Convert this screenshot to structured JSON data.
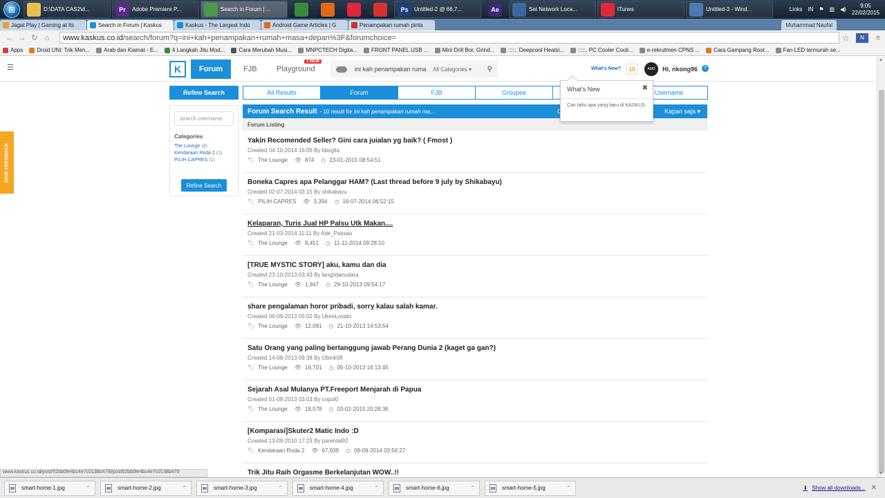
{
  "taskbar": {
    "items": [
      {
        "label": "D:\\DATA CAS2\\d...",
        "icon": "folder-icon",
        "color": "#e8c050"
      },
      {
        "label": "Adobe Premiere P...",
        "icon": "premiere-icon",
        "color": "#5a2a8a",
        "glyph": "Pr"
      },
      {
        "label": "Search in Forum | ...",
        "icon": "chrome-icon",
        "color": "#4a9a4a",
        "active": true
      },
      {
        "label": "",
        "icon": "sync-icon",
        "color": "#3a8a3a"
      },
      {
        "label": "",
        "icon": "firefox-icon",
        "color": "#e06a1a"
      },
      {
        "label": "",
        "icon": "itunes-icon",
        "color": "#e0283a"
      },
      {
        "label": "",
        "icon": "itunes-badge-icon",
        "color": "#d93030"
      },
      {
        "label": "Untitled-2 @ 66,7...",
        "icon": "photoshop-icon",
        "color": "#1b3f7a",
        "glyph": "Ps"
      },
      {
        "label": "",
        "icon": "after-effects-icon",
        "color": "#3b2a7a",
        "glyph": "Ae"
      },
      {
        "label": "Set Network Loca...",
        "icon": "network-icon",
        "color": "#3a6aa0"
      },
      {
        "label": "iTunes",
        "icon": "itunes-icon",
        "color": "#e0283a"
      },
      {
        "label": "Untitled-3 - Wind...",
        "icon": "moviemaker-icon",
        "color": "#4a7ab0"
      }
    ],
    "links": "Links",
    "lang": "IN",
    "time": "9:05",
    "date": "22/02/2015"
  },
  "browser_tabs": [
    {
      "label": "Jagat Play | Gaming at its",
      "color": "#e8a030"
    },
    {
      "label": "Search in Forum | Kaskus",
      "color": "#1c8fdb",
      "active": true
    },
    {
      "label": "Kaskus - The Largest Indo",
      "color": "#1c8fdb"
    },
    {
      "label": "Android Game Articles | G",
      "color": "#e06a1a"
    },
    {
      "label": "Penampakan rumah pinta",
      "color": "#d03030"
    }
  ],
  "browser_user": "Muhammad Naufal",
  "omnibox": {
    "host": "www.kaskus.co.id",
    "path": "/search/forum?q=ini+kah+penampakan+rumah+masa+depan%3F&forumchoice="
  },
  "bookmarks": [
    {
      "label": "Apps",
      "color": "#d04040"
    },
    {
      "label": "Droid UNI: Trik Men...",
      "color": "#e07a20"
    },
    {
      "label": "Arab dan Kiamat - E...",
      "color": "#888888"
    },
    {
      "label": "4 Langkah Jitu Mod...",
      "color": "#3a8a3a"
    },
    {
      "label": "Cara Merubah Musi...",
      "color": "#555555"
    },
    {
      "label": "MNPCTECH Digita...",
      "color": "#888888"
    },
    {
      "label": "FRONT PANEL USB ...",
      "color": "#888888"
    },
    {
      "label": "Mini Drill Bor, Grind...",
      "color": "#888888"
    },
    {
      "label": ":::::. Deepcool Heatsi...",
      "color": "#888888"
    },
    {
      "label": ":::::. PC Cooler Cooli...",
      "color": "#888888"
    },
    {
      "label": "e-rekrutmen CPNS ...",
      "color": "#888888"
    },
    {
      "label": "Cara Gampang Root...",
      "color": "#e07a20"
    },
    {
      "label": "Fan LED termurah se...",
      "color": "#888888"
    }
  ],
  "kaskus": {
    "nav_forum": "Forum",
    "nav_fjb": "FJB",
    "nav_playground": "Playground",
    "new_badge": "1 NEW",
    "search_query": "ini kah penampakan ruma",
    "search_category": "All Categories",
    "whats_new_link": "What's New?",
    "whats_new_count": "10",
    "avatar_text": "AMD",
    "greeting": "Hi, nkong96",
    "feedback": "GIVE FEEDBACK"
  },
  "sidebar": {
    "refine_title": "Refine Search",
    "username_placeholder": "search username",
    "categories_heading": "Categories",
    "categories": [
      {
        "name": "The Lounge",
        "count": "(8)"
      },
      {
        "name": "Kendaraan Roda 2",
        "count": "(1)"
      },
      {
        "name": "PILIH CAPRES",
        "count": "(1)"
      }
    ],
    "refine_button": "Refine Search"
  },
  "filter_tabs": [
    {
      "label": "All Results"
    },
    {
      "label": "Forum",
      "active": true
    },
    {
      "label": "FJB"
    },
    {
      "label": "Groupee"
    },
    {
      "label": ""
    },
    {
      "label": "Username"
    }
  ],
  "results": {
    "title": "Forum Search Result",
    "summary_prefix": "- 10 result for",
    "summary_query": "ini kah penampakan rumah ma...",
    "extra": "C",
    "time_filter": "Kapan saja",
    "listing_heading": "Forum Listing"
  },
  "popup": {
    "title": "What's New",
    "body": "Cari tahu apa yang baru di KASKUS."
  },
  "threads": [
    {
      "title": "Yakin Recomended Seller? Gini cara juialan yg baik? ( Fmost )",
      "created": "Created 04-10-2014 16:09 By bbxgila",
      "category": "The Lounge",
      "views": "874",
      "last": "23-01-2015 08:54:51"
    },
    {
      "title": "Boneka Capres apa Pelanggar HAM? (Last thread before 9 july by Shikabayu)",
      "created": "Created 02-07-2014 03:15 By shikabayu",
      "category": "PILIH CAPRES",
      "views": "3,394",
      "last": "16-07-2014 06:52:15"
    },
    {
      "title": "Kelaparan, Turis Jual HP Palsu Utk Makan....",
      "created": "Created 21-03-2014 11:11 By Ade_Passau",
      "category": "The Lounge",
      "views": "8,451",
      "last": "11-11-2014 09:28:10",
      "underline": true
    },
    {
      "title": "[TRUE MYSTIC STORY] aku, kamu dan dia",
      "created": "Created 23-10-2013 03:43 By langitdanudara",
      "category": "The Lounge",
      "views": "1,947",
      "last": "29-10-2013 09:54:17"
    },
    {
      "title": "share pengalaman horor pribadi, sorry kalau salah kamar.",
      "created": "Created 06-09-2013 05:02 By UkeeLovato",
      "category": "The Lounge",
      "views": "12,091",
      "last": "21-10-2013 14:53:54"
    },
    {
      "title": "Satu Orang yang paling bertanggung jawab Perang Dunia 2 (kaget ga gan?)",
      "created": "Created 14-08-2013 09:38 By Obink08",
      "category": "The Lounge",
      "views": "16,701",
      "last": "05-10-2013 16:13:45"
    },
    {
      "title": "Sejarah Asal Mulanya PT.Freeport Menjarah di Papua",
      "created": "Created 01-08-2013 03:03 By copol0",
      "category": "The Lounge",
      "views": "18,578",
      "last": "03-02-2015 20:28:36"
    },
    {
      "title": "[Komparasi]Skuter2 Matic Indo :D",
      "created": "Created 13-09-2010 17:23 By parental92",
      "category": "Kendaraan Roda 2",
      "views": "67,939",
      "last": "09-09-2014 03:56:27"
    },
    {
      "title": "Trik Jitu Raih Orgasme Berkelanjutan WOW..!!",
      "created": "",
      "category": "",
      "views": "",
      "last": ""
    }
  ],
  "status_url": "www.kaskus.co.id/post/52bb0fe4bc4e7c0138b479#post52bb0fe4bc4e7c0138b479",
  "downloads": {
    "files": [
      "smart-home-1.jpg",
      "smart-home-2.jpg",
      "smart-home-3.jpg",
      "smart-home-4.jpg",
      "smart-home-6.jpg",
      "smart-home-5.jpg"
    ],
    "show_all": "Show all downloads..."
  }
}
